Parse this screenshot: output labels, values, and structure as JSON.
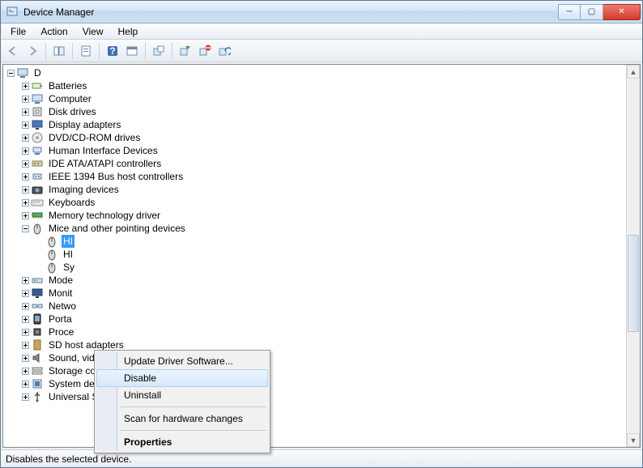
{
  "window": {
    "title": "Device Manager"
  },
  "menubar": [
    "File",
    "Action",
    "View",
    "Help"
  ],
  "toolbar_icons": [
    "back-arrow-icon",
    "forward-arrow-icon",
    "",
    "show-hide-tree-icon",
    "properties-icon",
    "",
    "help-icon",
    "options-icon",
    "",
    "update-driver-icon",
    "",
    "enable-icon",
    "disable-icon",
    "uninstall-icon"
  ],
  "tree": {
    "root": {
      "label": "D",
      "expanded": true
    },
    "categories": [
      {
        "label": "Batteries",
        "icon": "battery-icon"
      },
      {
        "label": "Computer",
        "icon": "computer-icon"
      },
      {
        "label": "Disk drives",
        "icon": "disk-icon"
      },
      {
        "label": "Display adapters",
        "icon": "display-icon"
      },
      {
        "label": "DVD/CD-ROM drives",
        "icon": "optical-icon"
      },
      {
        "label": "Human Interface Devices",
        "icon": "hid-icon"
      },
      {
        "label": "IDE ATA/ATAPI controllers",
        "icon": "ide-icon"
      },
      {
        "label": "IEEE 1394 Bus host controllers",
        "icon": "ieee1394-icon"
      },
      {
        "label": "Imaging devices",
        "icon": "imaging-icon"
      },
      {
        "label": "Keyboards",
        "icon": "keyboard-icon"
      },
      {
        "label": "Memory technology driver",
        "icon": "memory-icon"
      },
      {
        "label": "Mice and other pointing devices",
        "icon": "mouse-icon",
        "expanded": true,
        "children": [
          {
            "label": "HI",
            "full": "HID-compliant mouse",
            "icon": "mouse-icon",
            "selected": true
          },
          {
            "label": "HI",
            "icon": "mouse-icon"
          },
          {
            "label": "Sy",
            "icon": "mouse-icon"
          }
        ]
      },
      {
        "label": "Mode",
        "icon": "modem-icon"
      },
      {
        "label": "Monit",
        "icon": "monitor-icon"
      },
      {
        "label": "Netwo",
        "icon": "network-icon"
      },
      {
        "label": "Porta",
        "icon": "portable-icon"
      },
      {
        "label": "Proce",
        "icon": "processor-icon"
      },
      {
        "label": "SD host adapters",
        "icon": "sd-icon"
      },
      {
        "label": "Sound, video and game controllers",
        "icon": "sound-icon"
      },
      {
        "label": "Storage controllers",
        "icon": "storage-icon"
      },
      {
        "label": "System devices",
        "icon": "system-icon"
      },
      {
        "label": "Universal Serial Bus controllers",
        "icon": "usb-icon"
      }
    ]
  },
  "contextmenu": {
    "items": [
      {
        "label": "Update Driver Software..."
      },
      {
        "label": "Disable",
        "hover": true
      },
      {
        "label": "Uninstall"
      },
      {
        "sep": true
      },
      {
        "label": "Scan for hardware changes"
      },
      {
        "sep": true
      },
      {
        "label": "Properties",
        "bold": true
      }
    ]
  },
  "statusbar": {
    "text": "Disables the selected device."
  }
}
